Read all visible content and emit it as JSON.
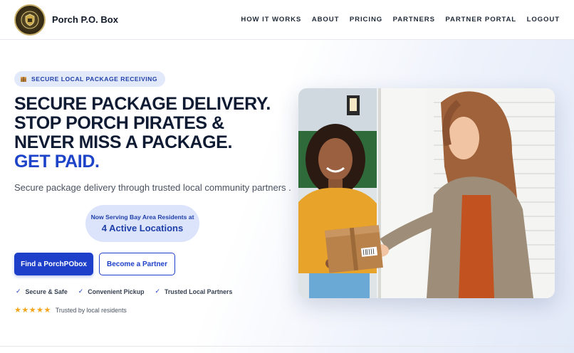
{
  "header": {
    "brand": "Porch P.O. Box",
    "nav": [
      {
        "label": "HOW IT WORKS"
      },
      {
        "label": "ABOUT"
      },
      {
        "label": "PRICING"
      },
      {
        "label": "PARTNERS"
      },
      {
        "label": "PARTNER PORTAL"
      },
      {
        "label": "LOGOUT"
      }
    ]
  },
  "hero": {
    "badge": "SECURE LOCAL PACKAGE RECEIVING",
    "headline": [
      "SECURE PACKAGE DELIVERY.",
      "STOP PORCH PIRATES &",
      "NEVER MISS A PACKAGE."
    ],
    "headline_accent": "GET PAID.",
    "subtitle": "Secure package delivery through trusted local community partners .",
    "locations": {
      "label": "Now Serving Bay Area Residents at",
      "count": "4 Active Locations"
    },
    "primary_button": "Find a PorchPObox",
    "secondary_button": "Become a Partner",
    "features": [
      {
        "label": "Secure & Safe"
      },
      {
        "label": "Convenient Pickup"
      },
      {
        "label": "Trusted Local Partners"
      }
    ],
    "rating": {
      "stars": 5,
      "text": "Trusted by local residents"
    }
  },
  "colors": {
    "accent": "#1d43c9",
    "star": "#f3a51c",
    "badge_bg": "#e2e9fb"
  }
}
